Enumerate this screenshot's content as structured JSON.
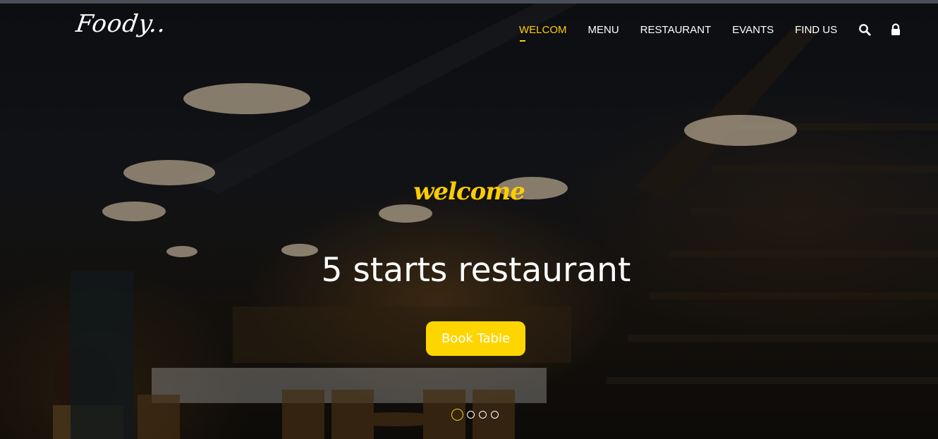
{
  "header": {
    "logo": "Foody..",
    "nav": [
      {
        "label": "WELCOM",
        "active": true
      },
      {
        "label": "MENU",
        "active": false
      },
      {
        "label": "RESTAURANT",
        "active": false
      },
      {
        "label": "EVANTS",
        "active": false
      },
      {
        "label": "FIND US",
        "active": false
      }
    ],
    "icons": [
      "search-icon",
      "lock-icon"
    ]
  },
  "hero": {
    "script_title": "welcome",
    "headline": "5 starts restaurant",
    "cta_label": "Book Table",
    "carousel": {
      "total": 4,
      "active_index": 0
    }
  },
  "colors": {
    "accent": "#ffcc00",
    "button": "#ffd500",
    "text": "#ffffff",
    "background": "#0d0d0f"
  }
}
